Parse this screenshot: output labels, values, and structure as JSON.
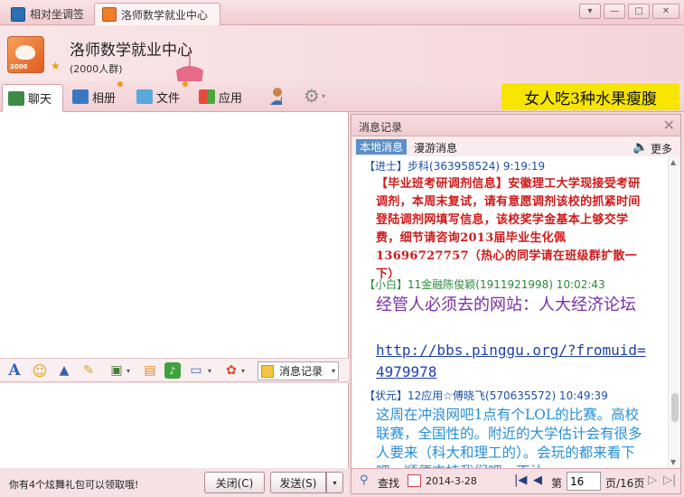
{
  "tabs": [
    {
      "label": "相对坐调签",
      "icon": "contacts-icon"
    },
    {
      "label": "洛师数学就业中心",
      "icon": "group-icon"
    }
  ],
  "window_controls": {
    "menu": "▾",
    "minimize": "—",
    "maximize": "□",
    "close": "✕"
  },
  "header": {
    "group_name": "洛师数学就业中心",
    "member_count": "(2000人群)",
    "avatar_badge": "2000"
  },
  "toolbar": {
    "chat": "聊天",
    "album": "相册",
    "file": "文件",
    "app": "应用"
  },
  "ad_banner": "女人吃3种水果瘦腹",
  "input_toolbar": {
    "history_label": "消息记录"
  },
  "bottom_bar": {
    "notice": "你有4个炫舞礼包可以领取哦!",
    "close_label": "关闭(C)",
    "send_label": "发送(S)"
  },
  "history": {
    "title": "消息记录",
    "tab_local": "本地消息",
    "tab_roaming": "漫游消息",
    "more_label": "更多",
    "messages": [
      {
        "rank": "【进士】",
        "sender": "步科(363958524) 9:19:19",
        "text": "【毕业班考研调剂信息】安徽理工大学现接受考研调剂，本周末复试，请有意愿调剂该校的抓紧时间登陆调剂网填写信息，该校奖学金基本上够交学费，细节请咨询2013届毕业生化佩13696727757（热心的同学请在班级群扩散一下）",
        "color": "#d01a1a"
      },
      {
        "rank": "【小白】",
        "sender": "11金融陈俊颖(1911921998) 10:02:43",
        "text": "经管人必须去的网站：人大经济论坛",
        "link": "http://bbs.pinggu.org/?fromuid=4979978",
        "color": "#7a2fa6"
      },
      {
        "rank": "【状元】",
        "sender": "12应用☆傅晓飞(570635572) 10:49:39",
        "text": "这周在冲浪网吧1点有个LOL的比赛。高校联赛，全国性的。附近的大学估计会有很多人要来（科大和理工的）。会玩的都来看下吧，顺便支持我们吧，不让",
        "color": "#2a8fd6"
      }
    ],
    "footer": {
      "search": "查找",
      "date": "2014-3-28",
      "page_prefix": "第",
      "page_current": "16",
      "page_total": "页/16页"
    }
  }
}
